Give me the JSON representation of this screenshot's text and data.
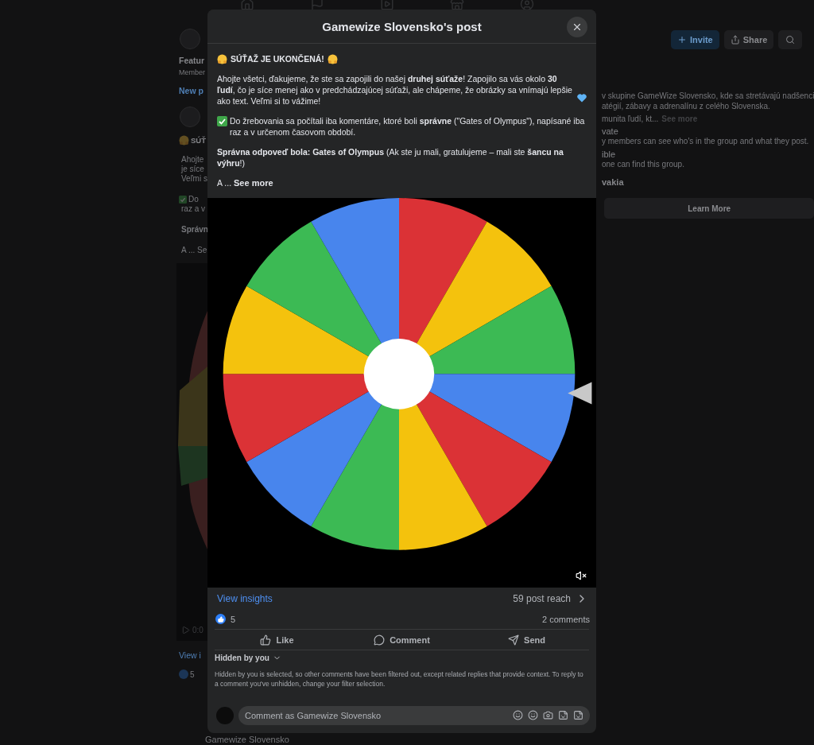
{
  "background_page": {
    "feed": {
      "group_name": "Featur",
      "group_meta": "Member",
      "new_post": "New p",
      "post_heading": "SÚŤ",
      "post_lines": [
        "Ahojte",
        "je síce",
        "Veľmi s"
      ],
      "check_lines": [
        "Do",
        "raz a v"
      ],
      "answer": "Správn",
      "more": "A ... Se",
      "video": {
        "kind": "picture",
        "time": "0:0"
      },
      "insights": "View i",
      "likes": "5"
    },
    "actions": [
      {
        "label": "Invite",
        "kind": "primary"
      },
      {
        "label": "Share",
        "kind": "share"
      }
    ],
    "about": {
      "lines": [
        "v skupine GameWize Slovensko, kde sa stretávajú nadšenci",
        "atégií, zábavy a adrenalínu z celého Slovenska."
      ],
      "last_line": "munita ľudí, kt...",
      "see_more": "See more",
      "facts": [
        {
          "title": "vate",
          "text": "y members can see who's in the group and what they post."
        },
        {
          "title": "ible",
          "text": "one can find this group."
        }
      ],
      "location": "vakia",
      "button": "Learn More"
    },
    "next_post_author": "Gamewize Slovensko"
  },
  "modal": {
    "title": "Gamewize Slovensko's post",
    "heading": "SÚŤAŽ JE UKONČENÁ!",
    "paragraphs": [
      {
        "kind": "heart",
        "text": "Ahojte všetci, ďakujeme, že ste sa zapojili do našej **druhej súťaže**! Zapojilo sa vás okolo **30 ľudí**, čo je síce menej ako v predchádzajúcej súťaži, ale chápeme, že obrázky sa vnímajú lepšie ako text. Veľmi si to vážime!"
      },
      {
        "kind": "check",
        "text": "Do žrebovania sa počítali iba komentáre, ktoré boli **správne** (\"Gates of Olympus\"), napísané iba raz a v určenom časovom období."
      },
      {
        "kind": "plain",
        "text": "**Správna odpoveď bola: Gates of Olympus** (Ak ste ju mali, gratulujeme – mali ste **šancu na výhru**!)"
      }
    ],
    "ellipsis": "A ...",
    "see_more": "See more",
    "video": {
      "kind": "picture",
      "muted": true
    },
    "insights": "View insights",
    "reach": "59 post reach",
    "reactions": "5",
    "comments": "2 comments",
    "actions": [
      {
        "label": "Like",
        "kind": "like"
      },
      {
        "label": "Comment",
        "kind": "comment"
      },
      {
        "label": "Send",
        "kind": "send"
      }
    ],
    "filter": "Hidden by you",
    "filter_note": "Hidden by you is selected, so other comments have been filtered out, except related replies that provide context. To reply to a comment you've unhidden, change your filter selection.",
    "composer": {
      "placeholder": "Comment as Gamewize Slovensko"
    }
  }
}
